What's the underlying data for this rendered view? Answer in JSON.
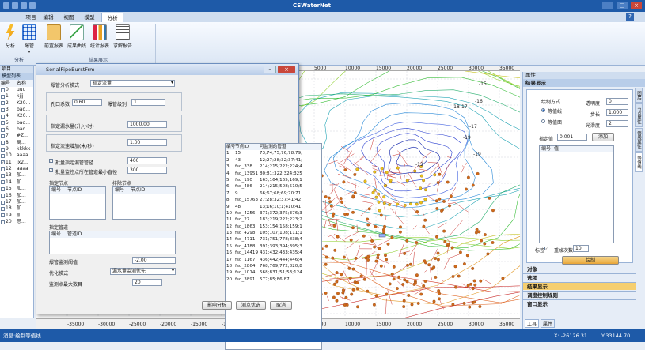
{
  "app": {
    "title": "CSWaterNet"
  },
  "tabs": [
    "项目",
    "编辑",
    "视图",
    "模型",
    "分析"
  ],
  "ribbon": {
    "buttons": [
      "分析",
      "爆管",
      "前置报表",
      "成果曲线",
      "统计报表",
      "求解报告"
    ],
    "group1": "分析",
    "group2": "结果展示"
  },
  "left_panel": {
    "header": "项目",
    "tab": "模型列表",
    "col_id": "编号",
    "col_name": "名称",
    "rows": [
      {
        "id": "0",
        "name": "uuu",
        "checked": false
      },
      {
        "id": "1",
        "name": "kjjj",
        "checked": false
      },
      {
        "id": "2",
        "name": "K20...",
        "checked": false
      },
      {
        "id": "3",
        "name": "bad...",
        "checked": false
      },
      {
        "id": "4",
        "name": "K20...",
        "checked": false
      },
      {
        "id": "5",
        "name": "bad...",
        "checked": false
      },
      {
        "id": "6",
        "name": "bad...",
        "checked": false
      },
      {
        "id": "7",
        "name": "#Z...",
        "checked": false
      },
      {
        "id": "8",
        "name": "萬...",
        "checked": false
      },
      {
        "id": "9",
        "name": "kkkkk",
        "checked": false
      },
      {
        "id": "10",
        "name": "aaaa",
        "checked": false
      },
      {
        "id": "11",
        "name": "jx2...",
        "checked": true
      },
      {
        "id": "12",
        "name": "aaaa",
        "checked": false
      },
      {
        "id": "13",
        "name": "加...",
        "checked": false
      },
      {
        "id": "14",
        "name": "加...",
        "checked": false
      },
      {
        "id": "15",
        "name": "加...",
        "checked": false
      },
      {
        "id": "16",
        "name": "加...",
        "checked": false
      },
      {
        "id": "17",
        "name": "加...",
        "checked": false
      },
      {
        "id": "18",
        "name": "加...",
        "checked": false
      },
      {
        "id": "19",
        "name": "加...",
        "checked": false
      },
      {
        "id": "20",
        "name": "思...",
        "checked": false
      }
    ]
  },
  "dialog": {
    "title": "SerialPipeBurstFrm",
    "mode_label": "爆管分析模式",
    "mode_value": "指定流量",
    "aperture_label": "孔口系数",
    "aperture_value": "0.60",
    "burst_level_label": "爆管级别",
    "burst_level_value": "1",
    "flow_label": "指定漏水量(升/小时)",
    "flow_value": "1000.00",
    "increment_label": "指定流速增加(米/秒)",
    "increment_value": "1.00",
    "batch_diameter_label": "批量指定漏管管径",
    "batch_diameter_value": "400",
    "batch_min_label": "批量监控点所在管道最小直径",
    "batch_min_value": "300",
    "specify_nodes_label": "指定节点",
    "exclude_nodes_label": "排除节点",
    "col_no": "编号",
    "col_node": "节点ID",
    "specify_pipes_label": "指定管道",
    "col_pipe": "管道ID",
    "threshold_label": "爆管监测阈值",
    "threshold_value": "-2.00",
    "optimize_label": "优化模式",
    "optimize_value": "漏水量监测优先",
    "max_points_label": "监测点最大数目",
    "max_points_value": "20",
    "btn_analyze": "影响分析",
    "btn_optimize": "测点优选",
    "btn_cancel": "取消",
    "table_headers": [
      "编号",
      "节点ID",
      "可监测的管道"
    ],
    "table_rows": [
      [
        "1",
        "15",
        "73;74;75;76;78;79;"
      ],
      [
        "2",
        "43",
        "12;27;28;32;37;41;"
      ],
      [
        "3",
        "fsd_338",
        "214;215;222;224;4"
      ],
      [
        "4",
        "fsd_13951",
        "80;81;322;324;325"
      ],
      [
        "5",
        "fsd_190",
        "163;164;165;169;1"
      ],
      [
        "6",
        "fsd_486",
        "214;215;508;510;5"
      ],
      [
        "7",
        "9",
        "66;67;68;69;70;71"
      ],
      [
        "8",
        "fsd_15763",
        "27;28;32;37;41;42"
      ],
      [
        "9",
        "48",
        "13;16;10;1;410;41"
      ],
      [
        "10",
        "fsd_4256",
        "371;372;375;376;3"
      ],
      [
        "11",
        "fsd_27",
        "183;219;222;223;2"
      ],
      [
        "12",
        "fsd_1863",
        "153;154;158;159;1"
      ],
      [
        "13",
        "fsd_4298",
        "105;107;108;111;1"
      ],
      [
        "14",
        "fsd_4711",
        "731;751;778;838;4"
      ],
      [
        "15",
        "fsd_4188",
        "391;393;394;395;3"
      ],
      [
        "16",
        "fsd_14419",
        "431;432;433;435;4"
      ],
      [
        "17",
        "fsd_1167",
        "436;442;444;446;4"
      ],
      [
        "18",
        "fsd_2864",
        "768;769;772;820;8"
      ],
      [
        "19",
        "fsd_1014",
        "568;831;51;53;124"
      ],
      [
        "20",
        "fsd_3891",
        "577;85;86;87;"
      ]
    ]
  },
  "chart_labels": {
    "top_ticks": [
      "5000",
      "10000",
      "15000",
      "20000",
      "25000",
      "30000",
      "35000"
    ],
    "bottom_ticks": [
      "-35000",
      "-30000",
      "-25000",
      "-20000",
      "-15000",
      "-10000",
      "-5000",
      "0",
      "5000",
      "10000",
      "15000",
      "20000",
      "25000",
      "30000",
      "35000"
    ],
    "contour_labels": [
      "-15",
      "-16",
      "-17",
      "-19",
      "-19",
      "-18-17",
      "-13"
    ]
  },
  "right_panel": {
    "header": "属性",
    "section": "结果显示",
    "draw_mode_label": "绘制方式",
    "radio1": "等值线",
    "radio2": "等值面",
    "transparency_label": "透明度",
    "transparency_value": "0",
    "step_label": "步长",
    "step_value": "1.000",
    "smooth_label": "光滑度",
    "smooth_value": "2",
    "specify_label": "指定值",
    "specify_value": "0.001",
    "add_label": "添加",
    "col_no": "编号",
    "col_value": "值",
    "mark_label": "标签",
    "repeat_label": "重绘次数",
    "repeat_value": "10",
    "draw_btn": "绘制",
    "side_tabs": [
      "图层",
      "节点属性",
      "管线属性",
      "等值线"
    ],
    "nav": [
      "对象",
      "选项",
      "结果显示",
      "调度控制规则",
      "窗口显示"
    ],
    "bottom_tabs": [
      "工具",
      "属性"
    ]
  },
  "status": {
    "left": "消息:绘制等值线",
    "x": "X: -26126.31",
    "y": "Y:33144.70"
  }
}
